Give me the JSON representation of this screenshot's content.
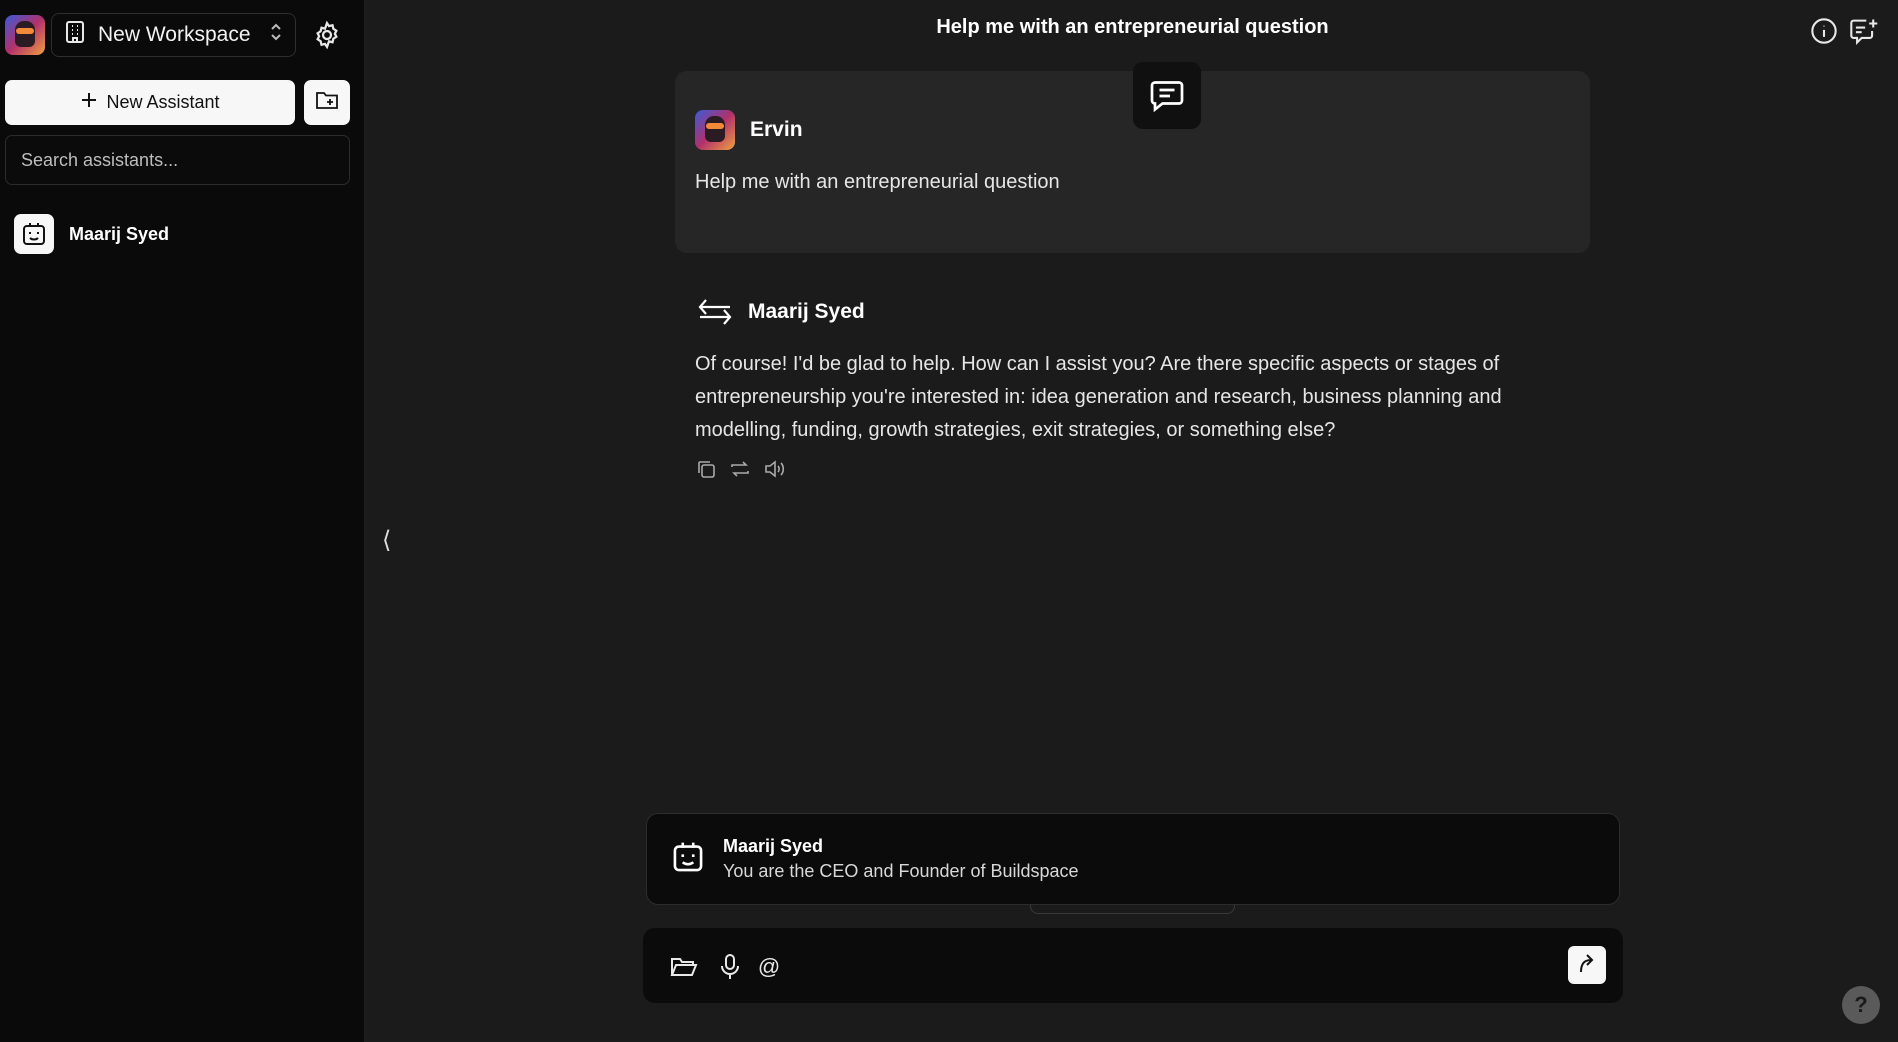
{
  "sidebar": {
    "workspace_name": "New Workspace",
    "new_assistant_label": "New Assistant",
    "search_placeholder": "Search assistants...",
    "assistants": [
      {
        "name": "Maarij Syed",
        "icon": "robot-face-icon"
      }
    ]
  },
  "header": {
    "title": "Help me with an entrepreneurial question"
  },
  "messages": [
    {
      "author": "Ervin",
      "text": "Help me with an entrepreneurial question"
    },
    {
      "author": "Maarij Syed",
      "text": "Of course! I'd be glad to help. How can I assist you? Are there specific aspects or stages of entrepreneurship you're interested in: idea generation and research, business planning and modelling, funding, growth strategies, exit strategies, or something else?"
    }
  ],
  "assistant_banner": {
    "name": "Maarij Syed",
    "description": "You are the CEO and Founder of Buildspace"
  },
  "composer": {
    "value": "",
    "mention_symbol": "@"
  },
  "collapse_symbol": "⟨",
  "help_symbol": "?",
  "colors": {
    "background": "#1b1b1b",
    "sidebar": "#0a0a0a",
    "card": "#262626",
    "button_light": "#f7f7f7"
  }
}
